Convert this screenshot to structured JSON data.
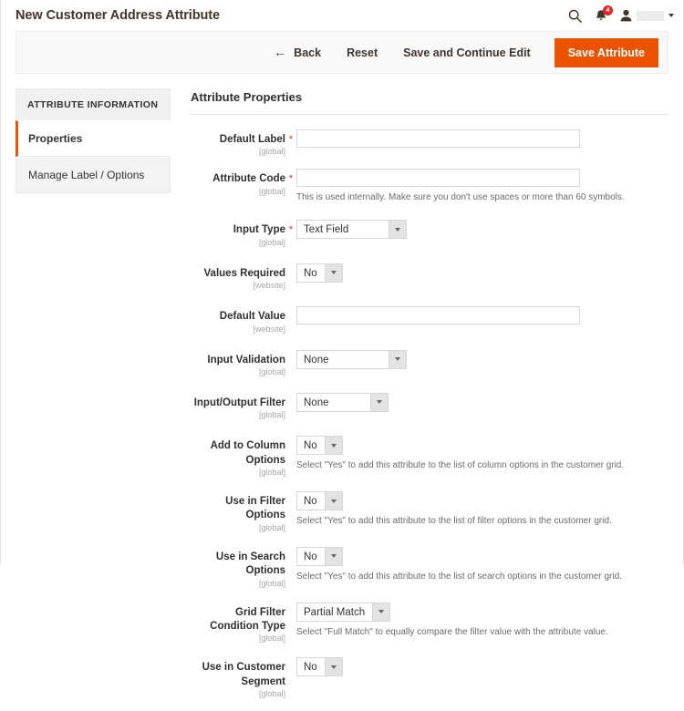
{
  "header": {
    "title": "New Customer Address Attribute",
    "search_icon": "search-icon",
    "notifications_icon": "bell-icon",
    "notifications_count": "4",
    "user_icon": "user-icon",
    "user_caret": "chevron-down-icon"
  },
  "actions": {
    "back_label": "Back",
    "back_icon": "arrow-left-icon",
    "reset_label": "Reset",
    "save_continue_label": "Save and Continue Edit",
    "save_label": "Save Attribute",
    "primary_color": "#eb5202"
  },
  "tabs": {
    "group_title": "ATTRIBUTE INFORMATION",
    "items": [
      {
        "label": "Properties",
        "active": true
      },
      {
        "label": "Manage Label / Options",
        "active": false
      }
    ]
  },
  "form": {
    "section_title": "Attribute Properties",
    "fields": [
      {
        "label": "Default Label",
        "scope": "[global]",
        "required": "*",
        "control": "text",
        "value": "",
        "placeholder": "",
        "note": ""
      },
      {
        "label": "Attribute Code",
        "scope": "[global]",
        "required": "*",
        "control": "text",
        "value": "",
        "placeholder": "",
        "note": "This is used internally. Make sure you don't use spaces or more than 60 symbols."
      },
      {
        "label": "Input Type",
        "scope": "[global]",
        "required": "*",
        "control": "select",
        "value": "Text Field",
        "note": ""
      },
      {
        "label": "Values Required",
        "scope": "[website]",
        "required": "",
        "control": "select",
        "value": "No",
        "note": ""
      },
      {
        "label": "Default Value",
        "scope": "[website]",
        "required": "",
        "control": "text",
        "value": "",
        "placeholder": "",
        "note": ""
      },
      {
        "label": "Input Validation",
        "scope": "[global]",
        "required": "",
        "control": "select",
        "value": "None",
        "note": ""
      },
      {
        "label": "Input/Output Filter",
        "scope": "[global]",
        "required": "",
        "control": "select",
        "value": "None",
        "note": ""
      },
      {
        "label": "Add to Column Options",
        "scope": "[global]",
        "required": "",
        "control": "select",
        "value": "No",
        "note": "Select \"Yes\" to add this attribute to the list of column options in the customer grid."
      },
      {
        "label": "Use in Filter Options",
        "scope": "[global]",
        "required": "",
        "control": "select",
        "value": "No",
        "note": "Select \"Yes\" to add this attribute to the list of filter options in the customer grid."
      },
      {
        "label": "Use in Search Options",
        "scope": "[global]",
        "required": "",
        "control": "select",
        "value": "No",
        "note": "Select \"Yes\" to add this attribute to the list of search options in the customer grid."
      },
      {
        "label": "Grid Filter Condition Type",
        "scope": "[global]",
        "required": "",
        "control": "select",
        "value": "Partial Match",
        "note": "Select \"Full Match\" to equally compare the filter value with the attribute value."
      },
      {
        "label": "Use in Customer Segment",
        "scope": "[global]",
        "required": "",
        "control": "select",
        "value": "No",
        "note": ""
      }
    ]
  }
}
